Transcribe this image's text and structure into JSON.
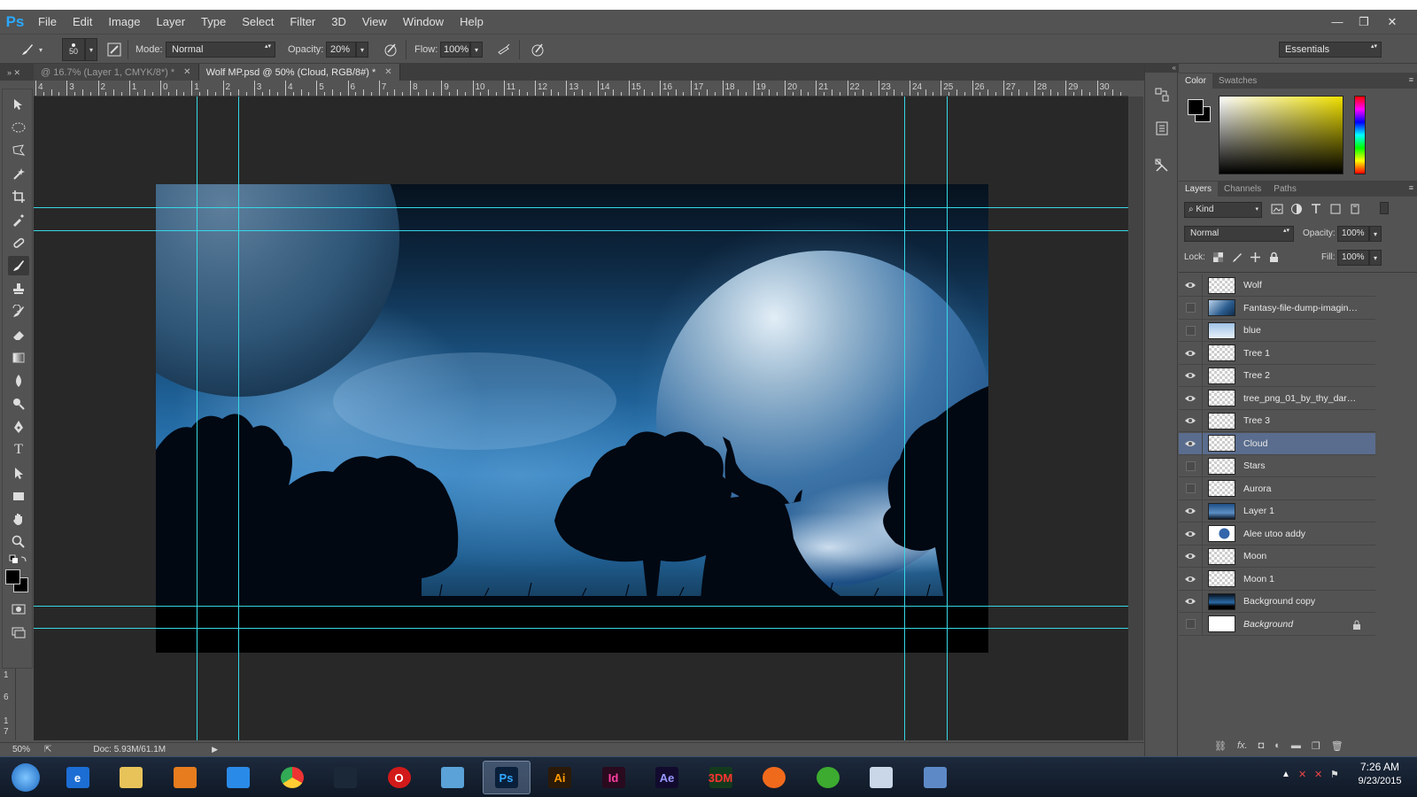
{
  "app": {
    "logo": "Ps"
  },
  "menu": [
    "File",
    "Edit",
    "Image",
    "Layer",
    "Type",
    "Select",
    "Filter",
    "3D",
    "View",
    "Window",
    "Help"
  ],
  "window_controls": {
    "minimize": "—",
    "restore": "❐",
    "close": "✕"
  },
  "options": {
    "brush_size": "50",
    "mode_label": "Mode:",
    "mode_value": "Normal",
    "opacity_label": "Opacity:",
    "opacity_value": "20%",
    "flow_label": "Flow:",
    "flow_value": "100%",
    "workspace": "Essentials"
  },
  "tabs": [
    {
      "label": "@ 16.7% (Layer 1, CMYK/8*) *",
      "active": false
    },
    {
      "label": "Wolf MP.psd @ 50% (Cloud, RGB/8#) *",
      "active": true
    }
  ],
  "ruler_top": [
    "4",
    "3",
    "2",
    "1",
    "0",
    "1",
    "2",
    "3",
    "4",
    "5",
    "6",
    "7",
    "8",
    "9",
    "10",
    "11",
    "12",
    "13",
    "14",
    "15",
    "16",
    "17",
    "18",
    "19",
    "20",
    "21",
    "22",
    "23",
    "24",
    "25",
    "26",
    "27",
    "28",
    "29",
    "30"
  ],
  "ruler_left": [
    "1",
    "6",
    "1",
    "7"
  ],
  "status": {
    "zoom": "50%",
    "doc": "Doc: 5.93M/61.1M"
  },
  "color_panel": {
    "tabs": [
      "Color",
      "Swatches"
    ],
    "active": "Color"
  },
  "layers_panel": {
    "tabs": [
      "Layers",
      "Channels",
      "Paths"
    ],
    "filter": "Kind",
    "blend_mode": "Normal",
    "opacity_label": "Opacity:",
    "opacity_value": "100%",
    "lock_label": "Lock:",
    "fill_label": "Fill:",
    "fill_value": "100%",
    "layers": [
      {
        "name": "Wolf",
        "visible": true
      },
      {
        "name": "Fantasy-file-dump-imaginati...",
        "visible": false
      },
      {
        "name": "blue",
        "visible": false
      },
      {
        "name": "Tree 1",
        "visible": true
      },
      {
        "name": "Tree 2",
        "visible": true
      },
      {
        "name": "tree_png_01_by_thy_darke...",
        "visible": true
      },
      {
        "name": "Tree 3",
        "visible": true
      },
      {
        "name": "Cloud",
        "visible": true,
        "selected": true
      },
      {
        "name": "Stars",
        "visible": false
      },
      {
        "name": "Aurora",
        "visible": false
      },
      {
        "name": "Layer 1",
        "visible": true
      },
      {
        "name": "Alee utoo addy",
        "visible": true
      },
      {
        "name": "Moon",
        "visible": true
      },
      {
        "name": "Moon 1",
        "visible": true
      },
      {
        "name": "Background copy",
        "visible": true
      },
      {
        "name": "Background",
        "visible": false,
        "locked": true
      }
    ]
  },
  "taskbar": {
    "apps": [
      {
        "icon": "windows-start-icon"
      },
      {
        "icon": "internet-explorer-icon",
        "label": "e"
      },
      {
        "icon": "file-explorer-icon"
      },
      {
        "icon": "media-player-icon"
      },
      {
        "icon": "browser-icon"
      },
      {
        "icon": "chrome-icon"
      },
      {
        "icon": "steam-icon"
      },
      {
        "icon": "opera-icon",
        "label": "O"
      },
      {
        "icon": "network-icon"
      },
      {
        "icon": "photoshop-icon",
        "label": "Ps",
        "active": true
      },
      {
        "icon": "illustrator-icon",
        "label": "Ai"
      },
      {
        "icon": "indesign-icon",
        "label": "Id"
      },
      {
        "icon": "after-effects-icon",
        "label": "Ae"
      },
      {
        "icon": "3dm-icon",
        "label": "3DM"
      },
      {
        "icon": "origin-icon"
      },
      {
        "icon": "utorrent-icon"
      },
      {
        "icon": "paint-icon"
      },
      {
        "icon": "screenshot-icon"
      }
    ],
    "clock_time": "7:26 AM",
    "clock_date": "9/23/2015"
  },
  "colors": {
    "accent": "#29a9ff",
    "guide": "#36d8e6",
    "selected_layer": "#5a6d8e"
  }
}
